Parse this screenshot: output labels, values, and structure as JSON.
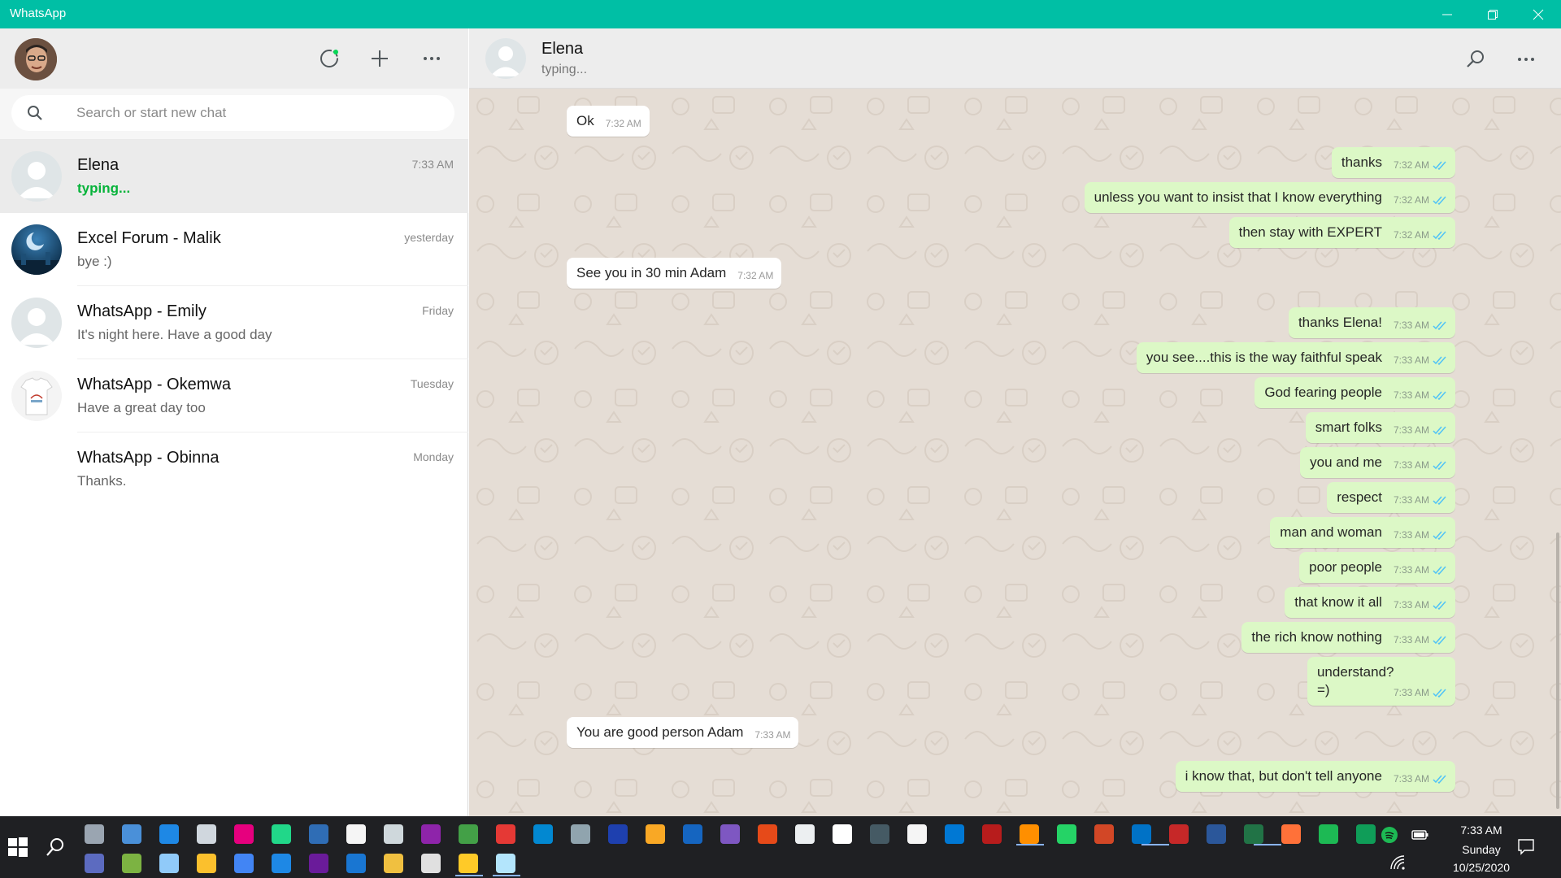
{
  "window": {
    "title": "WhatsApp",
    "accent": "#00bfa5"
  },
  "sidebar": {
    "header_icons": [
      "status-icon",
      "new-chat-icon",
      "menu-icon"
    ],
    "search": {
      "placeholder": "Search or start new chat",
      "value": ""
    },
    "chats": [
      {
        "name": "Elena",
        "time": "7:33 AM",
        "preview": "typing...",
        "typing": true,
        "active": true
      },
      {
        "name": "Excel Forum - Malik",
        "time": "yesterday",
        "preview": "bye :)",
        "typing": false,
        "active": false
      },
      {
        "name": "WhatsApp - Emily",
        "time": "Friday",
        "preview": "It's night here. Have a good day",
        "typing": false,
        "active": false
      },
      {
        "name": "WhatsApp - Okemwa",
        "time": "Tuesday",
        "preview": "Have a great day too",
        "typing": false,
        "active": false
      },
      {
        "name": "WhatsApp - Obinna",
        "time": "Monday",
        "preview": "Thanks.",
        "typing": false,
        "active": false
      }
    ]
  },
  "conversation": {
    "contact_name": "Elena",
    "contact_status": "typing...",
    "messages": [
      {
        "dir": "in",
        "text": "Ok",
        "time": "7:32 AM"
      },
      {
        "dir": "out",
        "text": "thanks",
        "time": "7:32 AM"
      },
      {
        "dir": "out",
        "text": "unless you want to insist that I know everything",
        "time": "7:32 AM"
      },
      {
        "dir": "out",
        "text": "then stay with EXPERT",
        "time": "7:32 AM"
      },
      {
        "dir": "in",
        "text": "See you in 30 min Adam",
        "time": "7:32 AM"
      },
      {
        "dir": "out",
        "text": "thanks Elena!",
        "time": "7:33 AM"
      },
      {
        "dir": "out",
        "text": "you see....this is the way faithful speak",
        "time": "7:33 AM"
      },
      {
        "dir": "out",
        "text": "God fearing people",
        "time": "7:33 AM"
      },
      {
        "dir": "out",
        "text": "smart folks",
        "time": "7:33 AM"
      },
      {
        "dir": "out",
        "text": "you and me",
        "time": "7:33 AM"
      },
      {
        "dir": "out",
        "text": "respect",
        "time": "7:33 AM"
      },
      {
        "dir": "out",
        "text": "man and woman",
        "time": "7:33 AM"
      },
      {
        "dir": "out",
        "text": "poor people",
        "time": "7:33 AM"
      },
      {
        "dir": "out",
        "text": "that know it all",
        "time": "7:33 AM"
      },
      {
        "dir": "out",
        "text": "the rich know nothing",
        "time": "7:33 AM"
      },
      {
        "dir": "out",
        "text": "understand? =)",
        "time": "7:33 AM"
      },
      {
        "dir": "in",
        "text": "You are good person Adam",
        "time": "7:33 AM"
      },
      {
        "dir": "out",
        "text": "i know that, but don't tell anyone",
        "time": "7:33 AM"
      }
    ]
  },
  "taskbar": {
    "clock_time": "7:33 AM",
    "clock_day": "Sunday",
    "clock_date": "10/25/2020"
  }
}
